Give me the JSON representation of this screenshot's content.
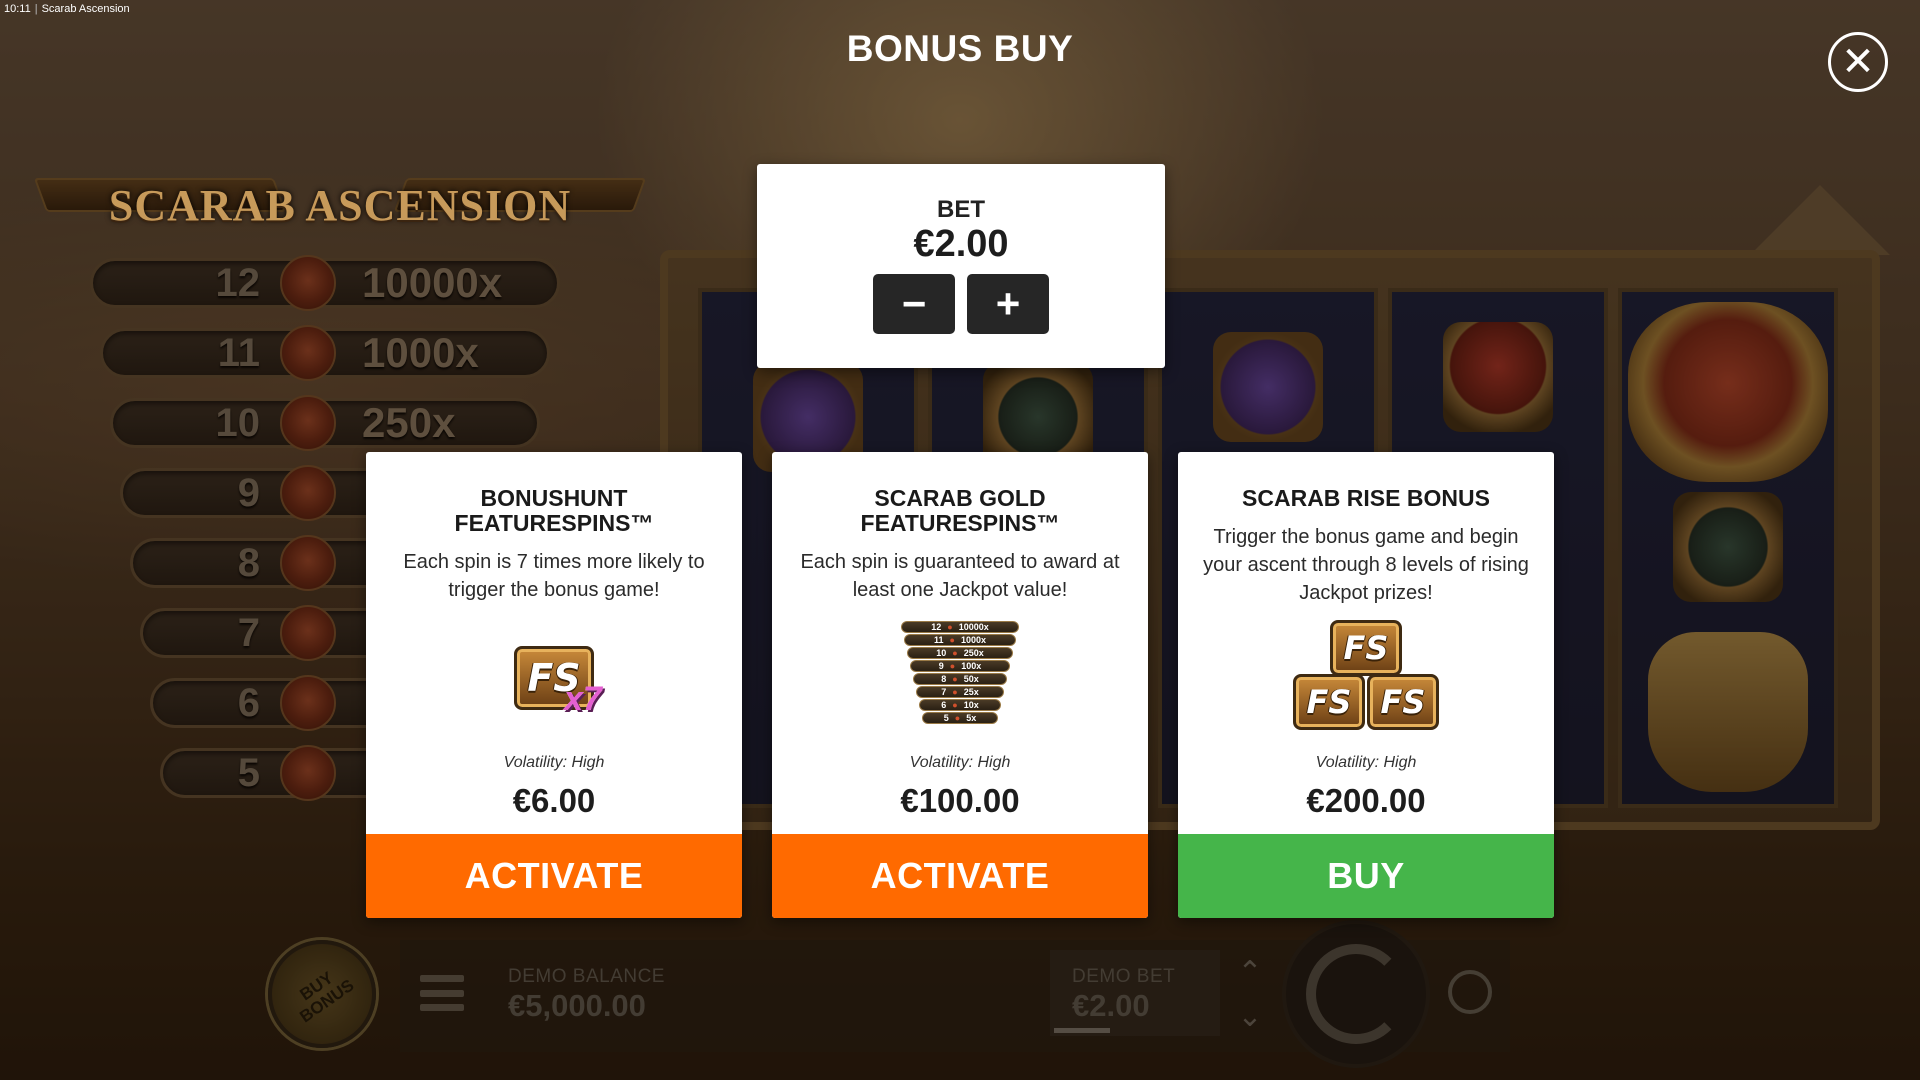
{
  "status_bar": {
    "time": "10:11",
    "title": "Scarab Ascension"
  },
  "game": {
    "logo": "SCARAB ASCENSION",
    "ladder": [
      {
        "level": "12",
        "mult": "10000x"
      },
      {
        "level": "11",
        "mult": "1000x"
      },
      {
        "level": "10",
        "mult": "250x"
      },
      {
        "level": "9",
        "mult": ""
      },
      {
        "level": "8",
        "mult": ""
      },
      {
        "level": "7",
        "mult": ""
      },
      {
        "level": "6",
        "mult": ""
      },
      {
        "level": "5",
        "mult": ""
      }
    ],
    "buy_bonus_label": "BUY BONUS",
    "hud": {
      "balance_label": "DEMO BALANCE",
      "balance_value": "€5,000.00",
      "bet_label": "DEMO BET",
      "bet_value": "€2.00"
    }
  },
  "modal": {
    "title": "BONUS BUY",
    "close_icon": "close-icon",
    "bet": {
      "label": "BET",
      "amount": "€2.00",
      "minus": "−",
      "plus": "+"
    },
    "cards": [
      {
        "title_line1": "BONUSHUNT",
        "title_line2": "FEATURESPINS™",
        "description": "Each spin is 7 times more likely to trigger the bonus game!",
        "art": {
          "tile": "FS",
          "badge": "x7"
        },
        "volatility": "Volatility: High",
        "price": "€6.00",
        "button": "ACTIVATE",
        "button_color": "#ff6a00"
      },
      {
        "title_line1": "SCARAB GOLD",
        "title_line2": "FEATURESPINS™",
        "description": "Each spin is guaranteed to award at least one Jackpot value!",
        "art": {
          "rungs": [
            {
              "level": "12",
              "mult": "10000x"
            },
            {
              "level": "11",
              "mult": "1000x"
            },
            {
              "level": "10",
              "mult": "250x"
            },
            {
              "level": "9",
              "mult": "100x"
            },
            {
              "level": "8",
              "mult": "50x"
            },
            {
              "level": "7",
              "mult": "25x"
            },
            {
              "level": "6",
              "mult": "10x"
            },
            {
              "level": "5",
              "mult": "5x"
            }
          ]
        },
        "volatility": "Volatility: High",
        "price": "€100.00",
        "button": "ACTIVATE",
        "button_color": "#ff6a00"
      },
      {
        "title_line1": "SCARAB RISE BONUS",
        "title_line2": "",
        "description": "Trigger the bonus game and begin your ascent through 8 levels of rising Jackpot prizes!",
        "art": {
          "tile": "FS"
        },
        "volatility": "Volatility: High",
        "price": "€200.00",
        "button": "BUY",
        "button_color": "#45b54a"
      }
    ]
  }
}
